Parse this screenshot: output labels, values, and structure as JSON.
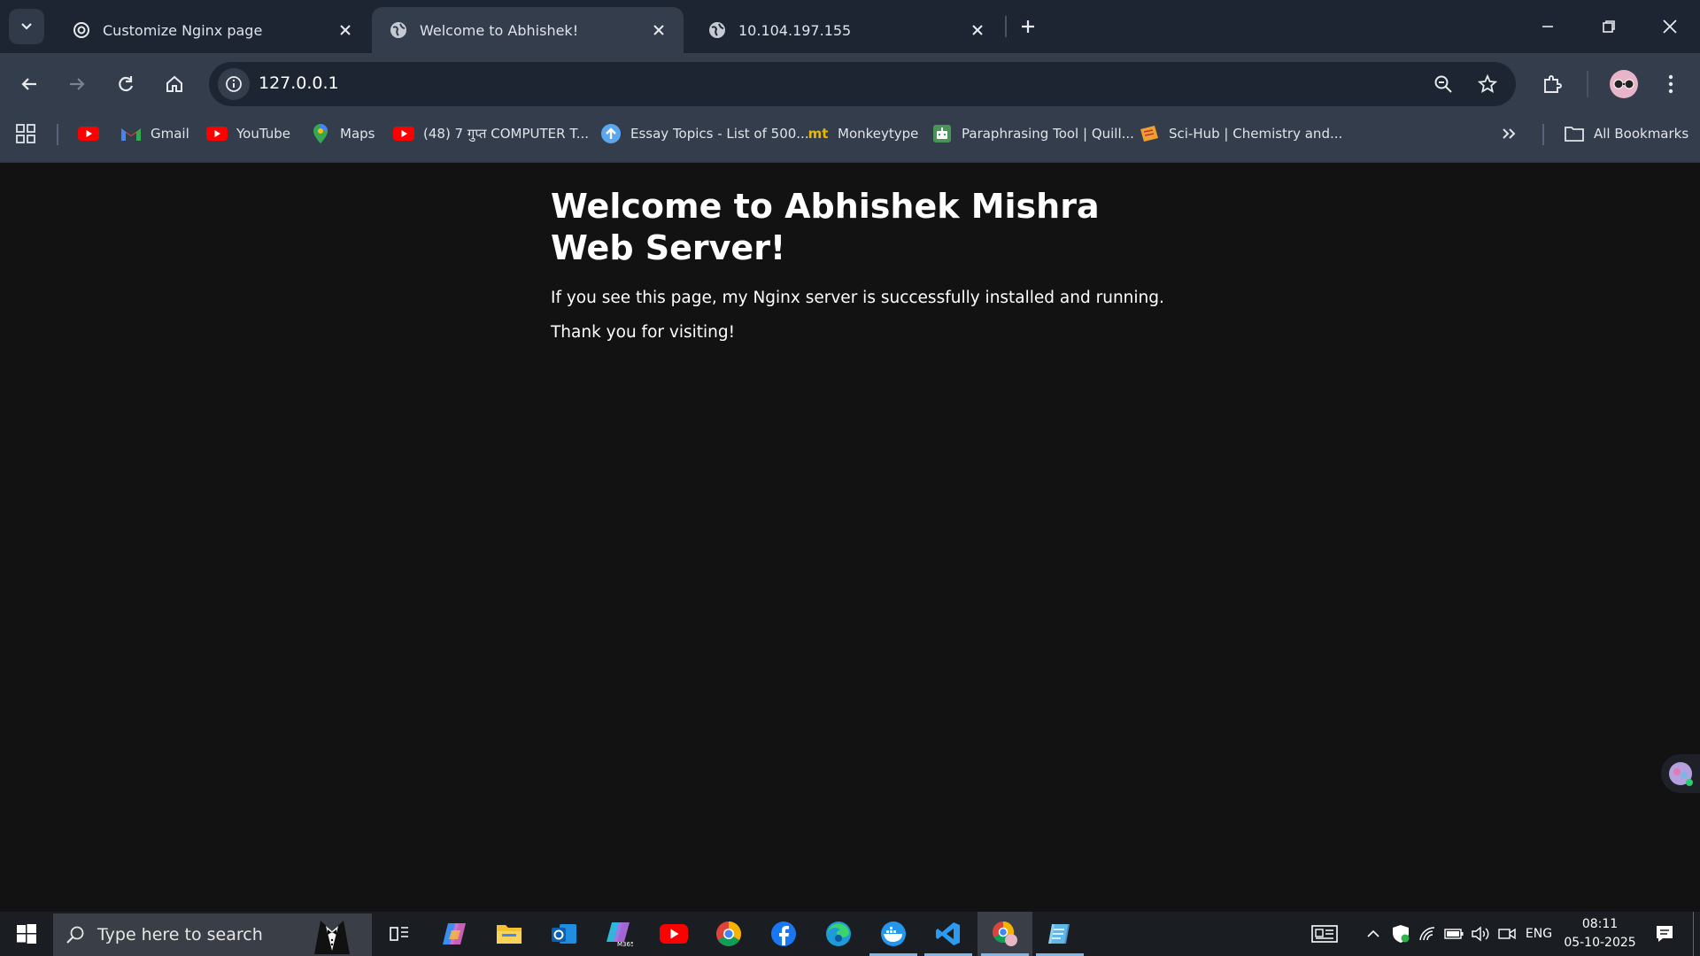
{
  "browser": {
    "tabs": [
      {
        "title": "Customize Nginx page",
        "icon": "openai-icon",
        "active": false
      },
      {
        "title": "Welcome to Abhishek!",
        "icon": "globe-icon",
        "active": true
      },
      {
        "title": "10.104.197.155",
        "icon": "globe-icon",
        "active": false
      }
    ],
    "url": "127.0.0.1",
    "bookmarks": [
      {
        "label": "",
        "icon": "youtube-icon"
      },
      {
        "label": "Gmail",
        "icon": "gmail-icon"
      },
      {
        "label": "YouTube",
        "icon": "youtube-icon"
      },
      {
        "label": "Maps",
        "icon": "maps-icon"
      },
      {
        "label": "(48) 7 गुप्त COMPUTER T...",
        "icon": "youtube-icon"
      },
      {
        "label": "Essay Topics - List of 500...",
        "icon": "upload-icon"
      },
      {
        "label": "Monkeytype",
        "icon": "monkeytype-icon"
      },
      {
        "label": "Paraphrasing Tool | Quill...",
        "icon": "quillbot-icon"
      },
      {
        "label": "Sci-Hub | Chemistry and...",
        "icon": "scihub-icon"
      }
    ],
    "all_bookmarks_label": "All Bookmarks"
  },
  "page": {
    "heading": "Welcome to Abhishek Mishra Web Server!",
    "line1": "If you see this page, my Nginx server is successfully installed and running.",
    "line2": "Thank you for visiting!"
  },
  "taskbar": {
    "search_placeholder": "Type here to search",
    "language": "ENG",
    "time": "08:11",
    "date": "05-10-2025"
  },
  "colors": {
    "tabstrip": "#1d2533",
    "toolbar": "#343d4b",
    "page_bg": "#121212",
    "taskbar": "#1a1d22"
  }
}
